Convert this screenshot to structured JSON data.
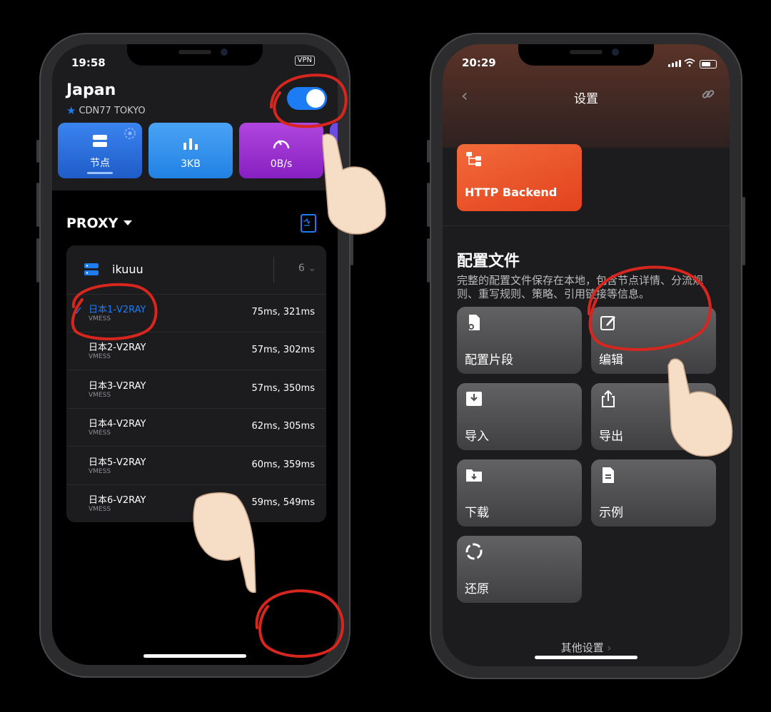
{
  "left": {
    "status": {
      "time": "19:58",
      "badge": "VPN"
    },
    "location": {
      "title": "Japan",
      "subtitle": "CDN77 TOKYO"
    },
    "tiles": [
      {
        "label": "节点",
        "color": "#2a6fdb"
      },
      {
        "label": "3KB",
        "color": "#2e8ee6"
      },
      {
        "label": "0B/s",
        "color": "#9b2bc9"
      }
    ],
    "proxy_header": "PROXY",
    "group": {
      "name": "ikuuu",
      "count": "6"
    },
    "nodes": [
      {
        "name": "日本1-V2RAY",
        "type": "VMESS",
        "latency": "75ms, 321ms",
        "selected": true
      },
      {
        "name": "日本2-V2RAY",
        "type": "VMESS",
        "latency": "57ms, 302ms"
      },
      {
        "name": "日本3-V2RAY",
        "type": "VMESS",
        "latency": "57ms, 350ms"
      },
      {
        "name": "日本4-V2RAY",
        "type": "VMESS",
        "latency": "62ms, 305ms"
      },
      {
        "name": "日本5-V2RAY",
        "type": "VMESS",
        "latency": "60ms, 359ms"
      },
      {
        "name": "日本6-V2RAY",
        "type": "VMESS",
        "latency": "59ms, 549ms"
      }
    ],
    "accent": "#1b7cf4"
  },
  "right": {
    "status": {
      "time": "20:29"
    },
    "nav_title": "设置",
    "backend_label": "HTTP Backend",
    "section_title": "配置文件",
    "section_desc": "完整的配置文件保存在本地，包含节点详情、分流规则、重写规则、策略、引用链接等信息。",
    "buttons": [
      "配置片段",
      "编辑",
      "导入",
      "导出",
      "下载",
      "示例",
      "还原"
    ],
    "other_settings": "其他设置"
  }
}
